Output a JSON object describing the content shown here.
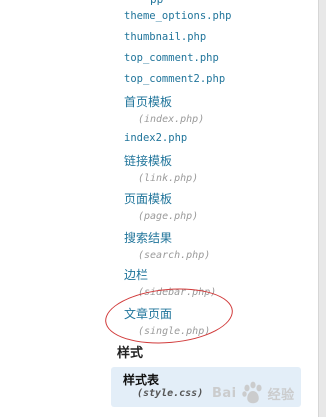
{
  "top_partial_text": "pp",
  "files": [
    {
      "name": "theme_options.php",
      "script": "mono"
    },
    {
      "name": "thumbnail.php",
      "script": "mono"
    },
    {
      "name": "top_comment.php",
      "script": "mono"
    },
    {
      "name": "top_comment2.php",
      "script": "mono"
    },
    {
      "name": "首页模板",
      "script": "cjk",
      "php": "(index.php)"
    },
    {
      "name": "index2.php",
      "script": "mono"
    },
    {
      "name": "链接模板",
      "script": "cjk",
      "php": "(link.php)"
    },
    {
      "name": "页面模板",
      "script": "cjk",
      "php": "(page.php)"
    },
    {
      "name": "搜索结果",
      "script": "cjk",
      "php": "(search.php)"
    },
    {
      "name": "边栏",
      "script": "cjk",
      "php": "(sidebar.php)"
    },
    {
      "name": "文章页面",
      "script": "cjk",
      "php": "(single.php)"
    }
  ],
  "styles_section": {
    "title": "样式",
    "item_label": "样式表",
    "item_php": "(style.css)"
  },
  "watermark": {
    "text_left": "Bai",
    "text_right": "经验"
  },
  "colors": {
    "link": "#21759b",
    "php_hint": "#9a9a9a",
    "highlight": "#d13a3a",
    "selected_bg": "#e3eef8"
  }
}
